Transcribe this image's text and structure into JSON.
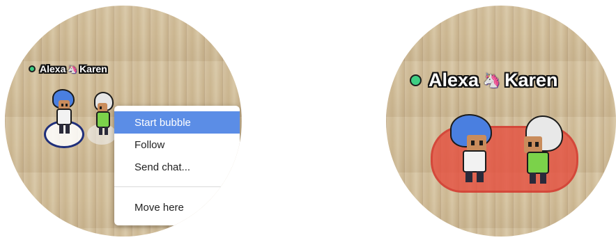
{
  "left_view": {
    "nametag": {
      "user": "Alexa",
      "friend": "Karen",
      "status_color": "#3fcf84"
    },
    "context_menu": {
      "items": [
        {
          "label": "Start bubble",
          "active": true
        },
        {
          "label": "Follow",
          "active": false
        },
        {
          "label": "Send chat...",
          "active": false
        },
        {
          "label": "Move here",
          "active": false
        }
      ],
      "highlight_color": "#5b8de6"
    }
  },
  "right_view": {
    "nametag": {
      "user": "Alexa",
      "friend": "Karen",
      "status_color": "#3fcf84"
    },
    "bubble_color": "#e64b3c"
  },
  "icons": {
    "unicorn": "🦄"
  }
}
